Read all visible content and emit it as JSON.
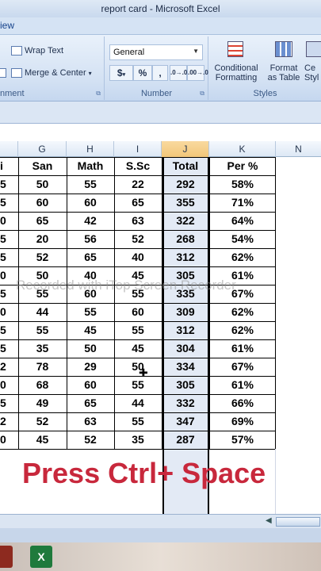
{
  "window": {
    "title": "report card - Microsoft Excel"
  },
  "ribbon": {
    "tab_partial": "iew",
    "alignment": {
      "wrap_text": "Wrap Text",
      "merge_center": "Merge & Center",
      "label": "nment"
    },
    "number": {
      "format_value": "General",
      "currency": "$",
      "percent": "%",
      "comma": ",",
      "inc_decimal": ".0→.00",
      "dec_decimal": ".00→.0",
      "label": "Number"
    },
    "styles": {
      "conditional": "Conditional",
      "formatting": "Formatting",
      "format": "Format",
      "as_table": "as Table",
      "cell_partial": "Ce",
      "cell_partial2": "Styl",
      "label": "Styles"
    }
  },
  "grid": {
    "columns": [
      {
        "name": "",
        "left": 0
      },
      {
        "name": "G"
      },
      {
        "name": "H"
      },
      {
        "name": "I"
      },
      {
        "name": "J"
      },
      {
        "name": "K"
      },
      {
        "name": "N"
      }
    ],
    "headers": [
      "i",
      "San",
      "Math",
      "S.Sc",
      "Total",
      "Per %"
    ],
    "rows": [
      [
        "5",
        "50",
        "55",
        "22",
        "292",
        "58%"
      ],
      [
        "5",
        "60",
        "60",
        "65",
        "355",
        "71%"
      ],
      [
        "0",
        "65",
        "42",
        "63",
        "322",
        "64%"
      ],
      [
        "5",
        "20",
        "56",
        "52",
        "268",
        "54%"
      ],
      [
        "5",
        "52",
        "65",
        "40",
        "312",
        "62%"
      ],
      [
        "0",
        "50",
        "40",
        "45",
        "305",
        "61%"
      ],
      [
        "5",
        "55",
        "60",
        "55",
        "335",
        "67%"
      ],
      [
        "0",
        "44",
        "55",
        "60",
        "309",
        "62%"
      ],
      [
        "5",
        "55",
        "45",
        "55",
        "312",
        "62%"
      ],
      [
        "5",
        "35",
        "50",
        "45",
        "304",
        "61%"
      ],
      [
        "2",
        "78",
        "29",
        "50",
        "334",
        "67%"
      ],
      [
        "0",
        "68",
        "60",
        "55",
        "305",
        "61%"
      ],
      [
        "5",
        "49",
        "65",
        "44",
        "332",
        "66%"
      ],
      [
        "2",
        "52",
        "63",
        "55",
        "347",
        "69%"
      ],
      [
        "0",
        "45",
        "52",
        "35",
        "287",
        "57%"
      ]
    ]
  },
  "overlay": {
    "watermark": "Recorded with iTop Screen Recorder",
    "caption": "Press Ctrl+ Space"
  },
  "taskbar": {
    "excel_icon": "X"
  }
}
